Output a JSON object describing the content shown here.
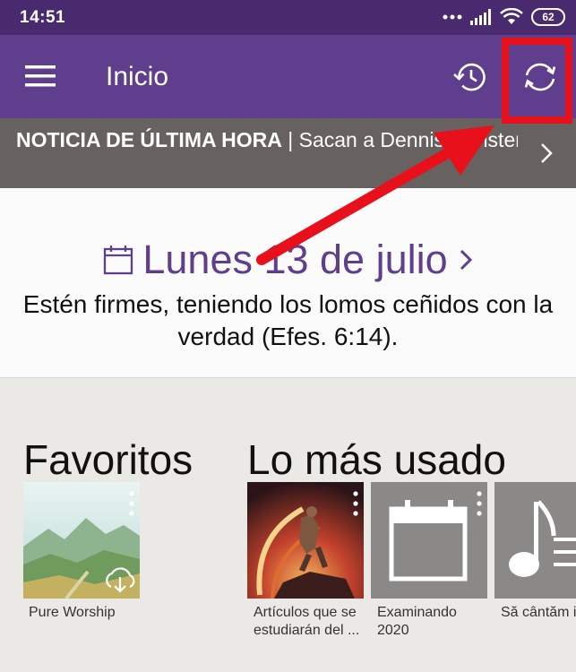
{
  "status_bar": {
    "time": "14:51",
    "battery": "62"
  },
  "app_bar": {
    "title": "Inicio"
  },
  "news": {
    "headline": "NOTICIA DE ÚLTIMA HORA",
    "separator": " | ",
    "text": "Sacan a Dennis Christensen de la celda especial de castigo"
  },
  "daily_text": {
    "date": "Lunes 13 de julio",
    "verse": "Estén firmes, teniendo los lomos ceñidos con la verdad (Efes. 6:14)."
  },
  "favorites": {
    "title": "Favoritos",
    "items": [
      {
        "label": "Pure Worship"
      }
    ]
  },
  "most_used": {
    "title": "Lo más usado",
    "items": [
      {
        "label": "Artículos que se estudiarán del ..."
      },
      {
        "label": "Examinando 2020"
      },
      {
        "label": "Să cântăm inimă"
      }
    ]
  },
  "colors": {
    "status_bar": "#4a2a6e",
    "app_bar": "#5f3e8e",
    "news_bar": "#676160",
    "accent": "#5f3e8e",
    "annotation": "#e8101a"
  },
  "icons": [
    "menu-icon",
    "history-icon",
    "sync-icon",
    "chevron-right-icon",
    "calendar-icon",
    "cloud-download-icon",
    "more-vert-icon",
    "music-note-icon"
  ]
}
